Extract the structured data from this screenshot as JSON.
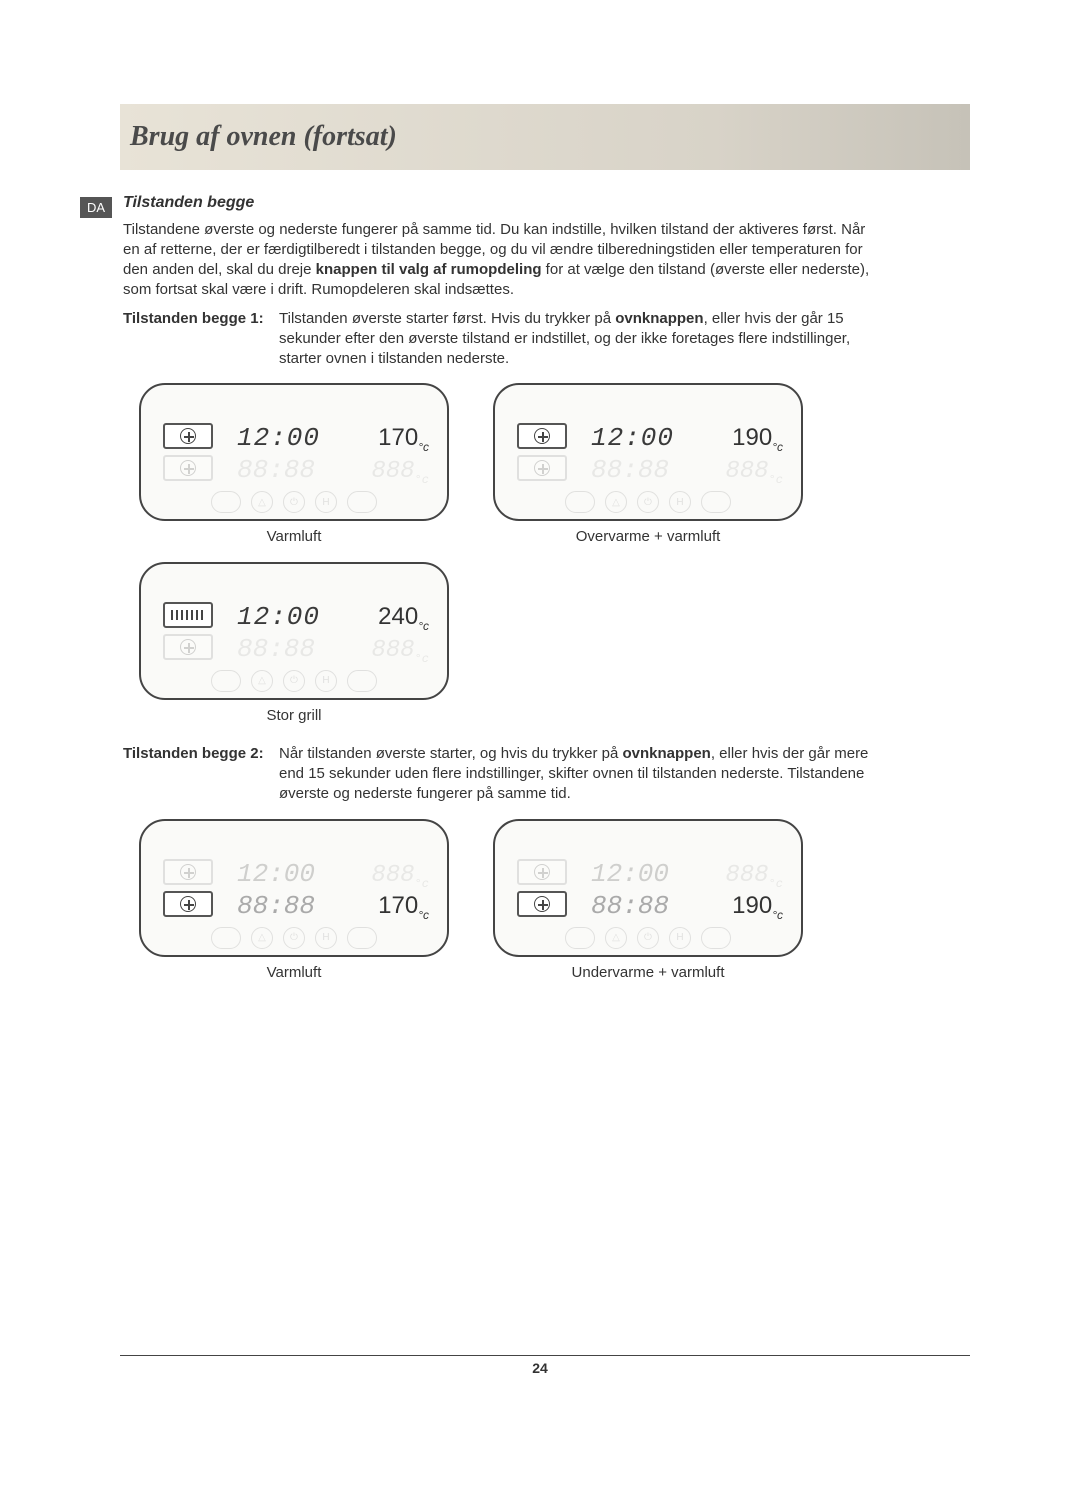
{
  "header": {
    "title": "Brug af ovnen (fortsat)"
  },
  "lang_badge": "DA",
  "subheading": "Tilstanden begge",
  "intro": {
    "p1a": "Tilstandene øverste og nederste fungerer på samme tid. Du kan indstille, hvilken tilstand der aktiveres først. Når en af retterne, der er færdigtilberedt i tilstanden begge, og du vil ændre tilberedningstiden eller temperaturen for den anden del, skal du dreje ",
    "bold1": "knappen til valg af rumopdeling",
    "p1b": " for at vælge den tilstand (øverste eller nederste), som fortsat skal være i drift. Rumopdeleren skal indsættes."
  },
  "mode1": {
    "label": "Tilstanden begge 1:",
    "desc_a": "Tilstanden øverste starter først. Hvis du trykker på ",
    "bold": "ovnknappen",
    "desc_b": ", eller hvis der går 15 sekunder efter den øverste tilstand er indstillet, og der ikke foretages flere indstillinger, starter ovnen i tilstanden nederste."
  },
  "mode2": {
    "label": "Tilstanden begge 2:",
    "desc_a": "Når tilstanden øverste starter, og hvis du trykker på ",
    "bold": "ovnknappen",
    "desc_b": ", eller hvis der går mere end 15 sekunder uden flere indstillinger, skifter ovnen til tilstanden nederste. Tilstandene øverste og nederste fungerer på samme tid."
  },
  "panels": {
    "ghost_time": "88:88",
    "ghost_temp": "888",
    "row1": [
      {
        "icon": "fan",
        "time": "12:00",
        "temp": "170",
        "active_row": "top",
        "caption": "Varmluft"
      },
      {
        "icon": "fan",
        "time": "12:00",
        "temp": "190",
        "active_row": "top",
        "caption": "Overvarme + varmluft"
      }
    ],
    "row2": [
      {
        "icon": "grill",
        "time": "12:00",
        "temp": "240",
        "active_row": "top",
        "caption": "Stor grill"
      }
    ],
    "row3": [
      {
        "icon": "fan",
        "time": "12:00",
        "temp": "170",
        "active_row": "bot",
        "caption": "Varmluft"
      },
      {
        "icon": "fan",
        "time": "12:00",
        "temp": "190",
        "active_row": "bot",
        "caption": "Undervarme + varmluft"
      }
    ]
  },
  "unit": "°c",
  "page_number": "24"
}
